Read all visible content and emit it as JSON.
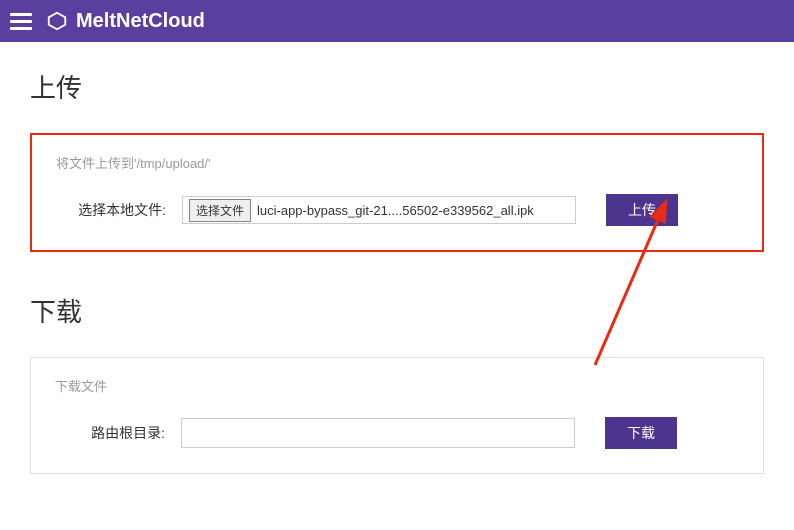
{
  "header": {
    "brand": "MeltNetCloud"
  },
  "upload": {
    "section_title": "上传",
    "subtitle": "将文件上传到'/tmp/upload/'",
    "row_label": "选择本地文件:",
    "choose_btn": "选择文件",
    "file_name": "luci-app-bypass_git-21....56502-e339562_all.ipk",
    "submit": "上传"
  },
  "download": {
    "section_title": "下载",
    "subtitle": "下载文件",
    "row_label": "路由根目录:",
    "input_value": "",
    "submit": "下载"
  },
  "colors": {
    "header_bg": "#5b3f9e",
    "button_bg": "#4d358f",
    "highlight_border": "#e82b11",
    "arrow": "#e82b11"
  }
}
